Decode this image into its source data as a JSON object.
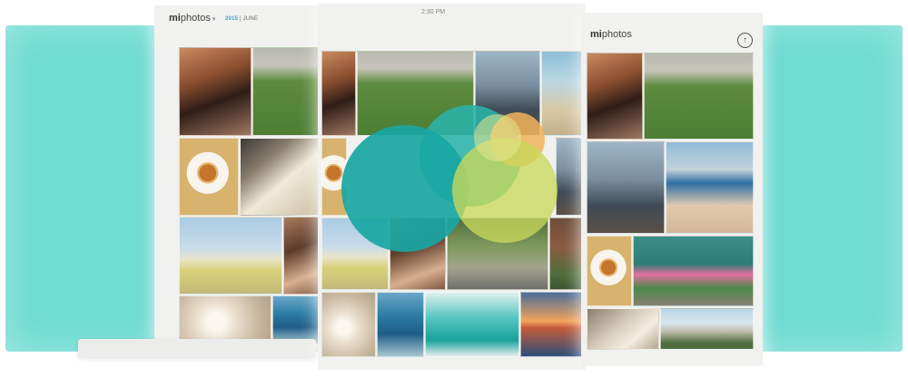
{
  "left_app": {
    "brand_bold": "mi",
    "brand_light": "photos",
    "year": "2015",
    "separator": "|",
    "month": "JUNE"
  },
  "middle_app": {
    "status_time": "2:30 PM"
  },
  "right_app": {
    "brand_bold": "mi",
    "brand_light": "photos"
  },
  "icons": {
    "upload": "↑",
    "dropdown": "▾"
  },
  "colors": {
    "background": "#6fdcd3",
    "accent": "#3aa4c9",
    "logo_circles": [
      "#19a6a3",
      "#3fc2b6",
      "#c9d85a",
      "#f2b35a"
    ]
  }
}
